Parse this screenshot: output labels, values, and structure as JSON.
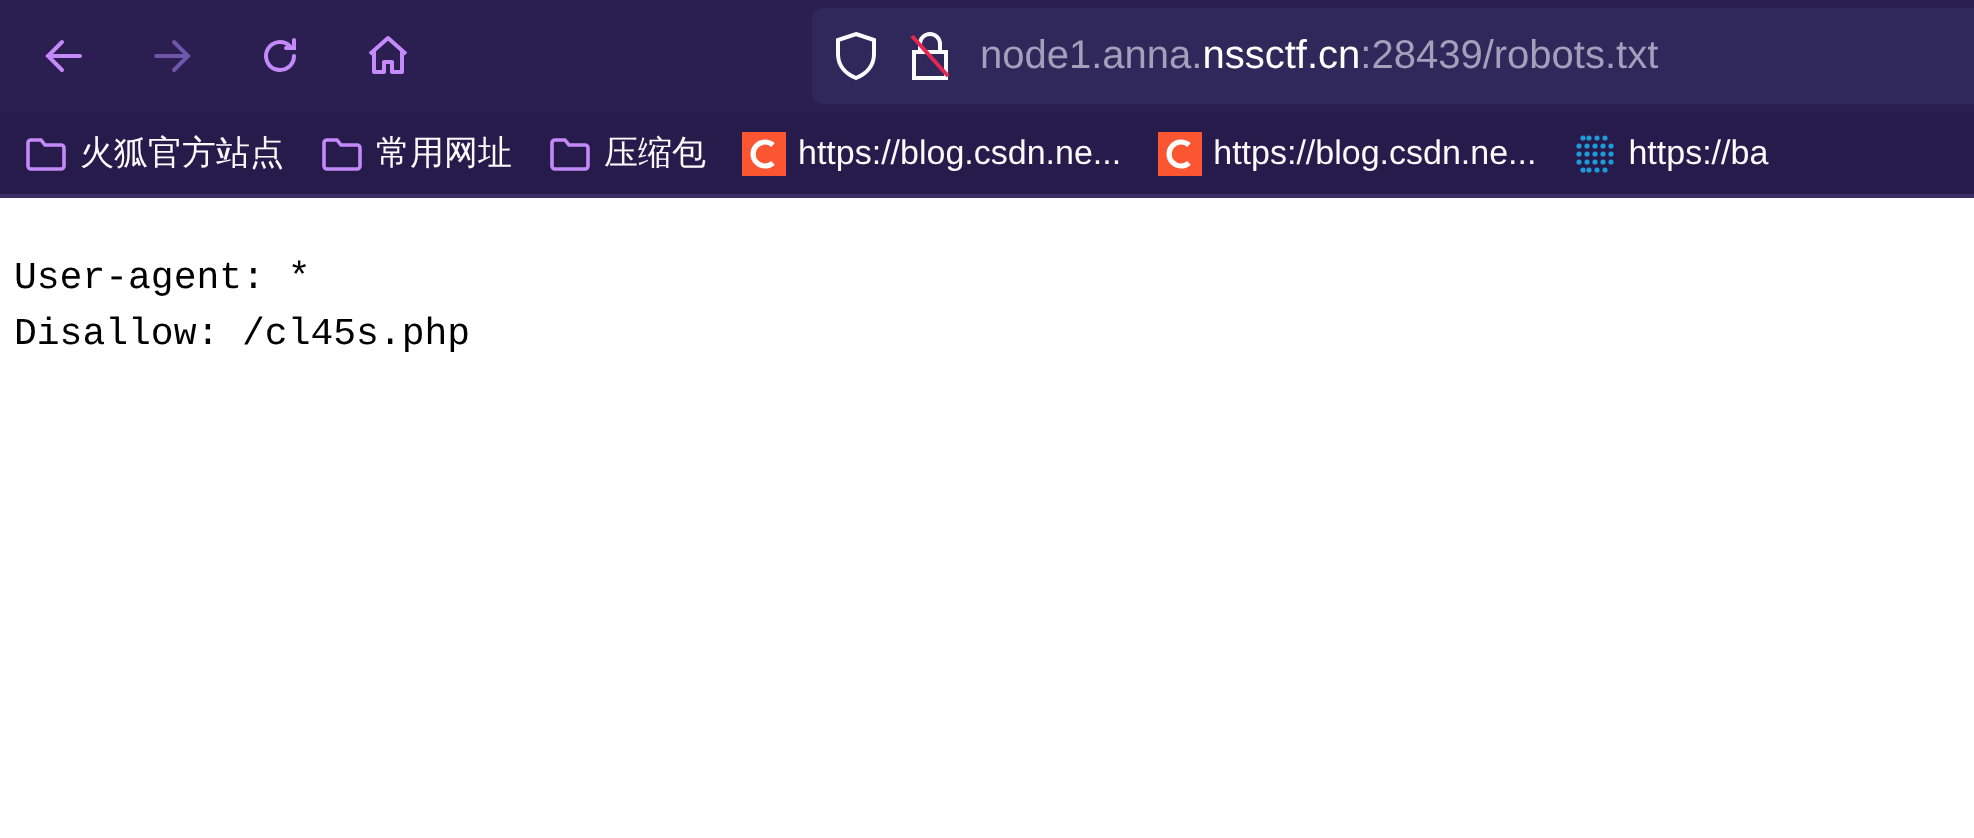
{
  "toolbar": {
    "back": {
      "disabled": false
    },
    "forward": {
      "disabled": true
    }
  },
  "address_bar": {
    "url_prefix": "node1.anna.",
    "url_domain": "nssctf.cn",
    "url_suffix": ":28439/robots.txt"
  },
  "bookmarks": [
    {
      "kind": "folder",
      "label": "火狐官方站点"
    },
    {
      "kind": "folder",
      "label": "常用网址"
    },
    {
      "kind": "folder",
      "label": "压缩包"
    },
    {
      "kind": "csdn",
      "label": "https://blog.csdn.ne..."
    },
    {
      "kind": "csdn",
      "label": "https://blog.csdn.ne..."
    },
    {
      "kind": "site",
      "label": "https://ba"
    }
  ],
  "document": {
    "lines": [
      "User-agent: *",
      "Disallow: /cl45s.php"
    ]
  }
}
